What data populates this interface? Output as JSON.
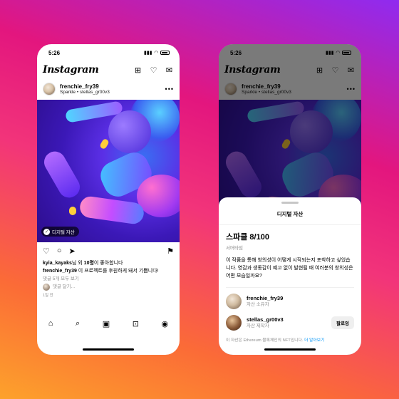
{
  "colors": {
    "link": "#0095f6",
    "background_start": "#8f2bf0",
    "background_end": "#fda22b"
  },
  "status": {
    "time": "5:26"
  },
  "app": {
    "logo": "Instagram"
  },
  "post": {
    "username": "frenchie_fry39",
    "subtitle": "Sparkle • stellas_gr00v3",
    "badge": "디지털 자산",
    "likes_user": "kyia_kayaks",
    "likes_mid": "님 외 ",
    "likes_count": "10명",
    "likes_tail": "이 좋아합니다",
    "caption_user": "frenchie_fry39",
    "caption_text": " 이 프로젝트를 후원하게 돼서 기쁩니다!",
    "view_comments": "댓글 5개 모두 보기",
    "add_comment": "댓글 달기...",
    "date": "1일 전"
  },
  "sheet": {
    "title": "디지털 자산",
    "asset_name": "스파클 8/100",
    "asset_type": "서머타임",
    "description": "이 작품을 통해 창의성이 어떻게 시작되는지 포착하고 싶었습니다. 영감과 생동감이 예고 없이 발현될 때 여러분의 창의성은 어떤 모습일까요?",
    "people": [
      {
        "name": "frenchie_fry39",
        "role": "자산 소유자"
      },
      {
        "name": "stellas_gr00v3",
        "role": "자산 제작자",
        "action": "팔로잉"
      }
    ],
    "footnote": "이 자산은 Ethereum 블록체인의 NFT입니다.",
    "learn_more": "더 알아보기"
  }
}
